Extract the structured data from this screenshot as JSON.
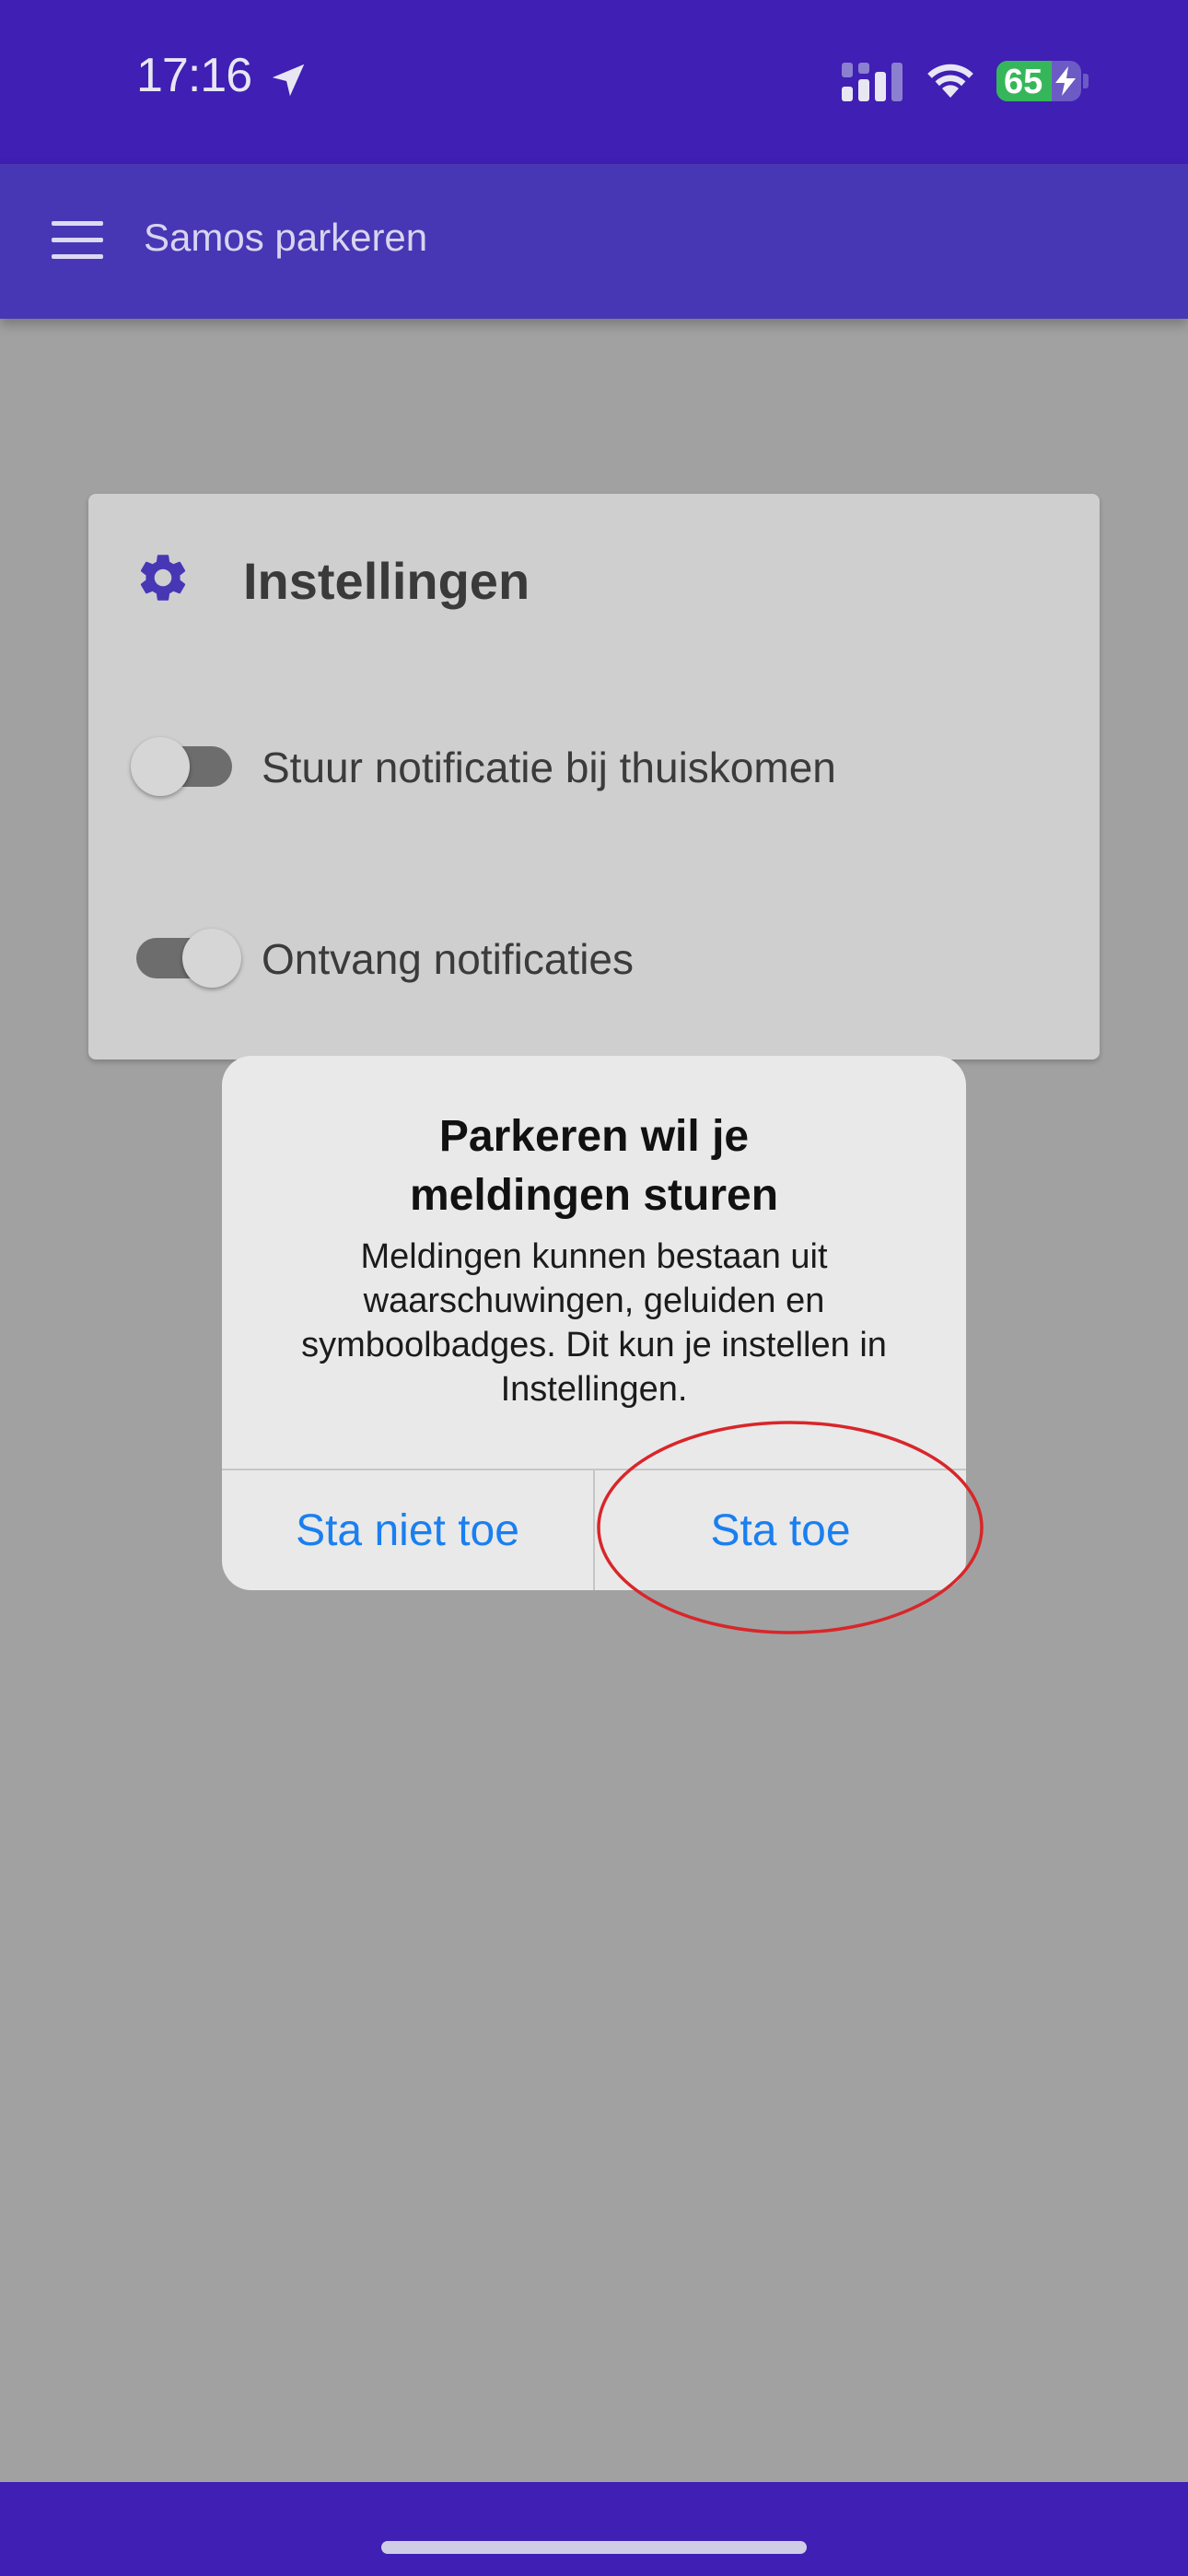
{
  "status_bar": {
    "time": "17:16",
    "battery_percent": "65",
    "battery_level": 0.65,
    "icons": [
      "location-arrow-icon",
      "cellular-signal-icon",
      "wifi-icon",
      "battery-charging-icon"
    ]
  },
  "app_bar": {
    "title": "Samos parkeren",
    "menu_icon": "hamburger-menu-icon"
  },
  "settings_card": {
    "icon": "gear-icon",
    "title": "Instellingen",
    "toggles": [
      {
        "label": "Stuur notificatie bij thuiskomen",
        "state": "off"
      },
      {
        "label": "Ontvang notificaties",
        "state": "on"
      }
    ]
  },
  "dialog": {
    "title_lines": [
      "Parkeren wil je",
      "meldingen sturen"
    ],
    "message_lines": [
      "Meldingen kunnen bestaan uit",
      "waarschuwingen, geluiden en",
      "symboolbadges. Dit kun je instellen in",
      "Instellingen."
    ],
    "deny_label": "Sta niet toe",
    "allow_label": "Sta toe"
  },
  "colors": {
    "status_bar": "#3f1fb4",
    "app_bar": "#4737b5",
    "overlay": "#a1a1a1",
    "dialog_button_text": "#1a7ff0",
    "highlight": "#d8262a",
    "battery_fill": "#36b65a"
  }
}
